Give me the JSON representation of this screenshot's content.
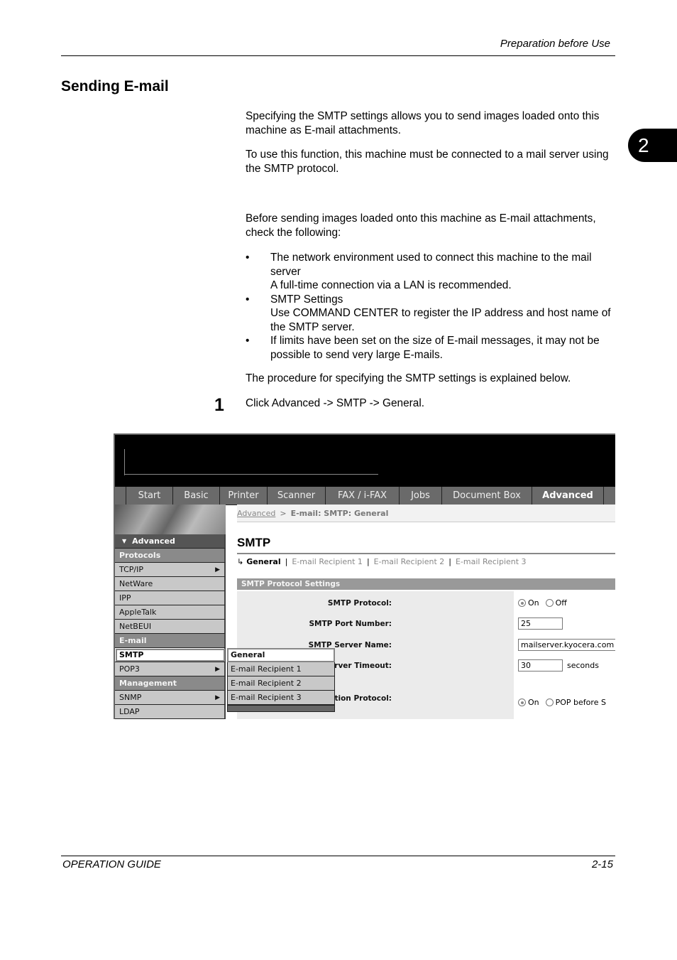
{
  "header": {
    "section_title": "Preparation before Use"
  },
  "chapter_tab": "2",
  "title": "Sending E-mail",
  "intro": [
    "Specifying the SMTP settings allows you to send images loaded onto this machine as E-mail attachments.",
    "To use this function, this machine must be connected to a mail server using the SMTP protocol."
  ],
  "check_intro": "Before sending images loaded onto this machine as E-mail attachments, check the following:",
  "bullets": [
    {
      "lines": [
        "The network environment used to connect this machine to the mail server",
        "A full-time connection via a LAN is recommended."
      ]
    },
    {
      "lines": [
        "SMTP Settings",
        "Use COMMAND CENTER to register the IP address and host name of the SMTP server."
      ]
    },
    {
      "lines": [
        "If limits have been set on the size of E-mail messages, it may not be possible to send very large E-mails."
      ]
    }
  ],
  "bullet_char": "•",
  "procedure_intro": "The procedure for specifying the SMTP settings is explained below.",
  "steps": [
    {
      "number": "1",
      "text": "Click Advanced -> SMTP -> General."
    }
  ],
  "screenshot": {
    "nav_tabs": [
      {
        "label": "Start"
      },
      {
        "label": "Basic"
      },
      {
        "label": "Printer"
      },
      {
        "label": "Scanner"
      },
      {
        "label": "FAX / i-FAX"
      },
      {
        "label": "Jobs"
      },
      {
        "label": "Document Box"
      },
      {
        "label": "Advanced",
        "active": true
      }
    ],
    "sidebar": {
      "header": "Advanced",
      "items": [
        {
          "label": "Protocols",
          "type": "group"
        },
        {
          "label": "TCP/IP",
          "arrow": true
        },
        {
          "label": "NetWare"
        },
        {
          "label": "IPP"
        },
        {
          "label": "AppleTalk"
        },
        {
          "label": "NetBEUI"
        },
        {
          "label": "E-mail",
          "type": "group"
        },
        {
          "label": "SMTP",
          "selected": true
        },
        {
          "label": "POP3",
          "arrow": true
        },
        {
          "label": "Management",
          "type": "group"
        },
        {
          "label": "SNMP",
          "arrow": true
        },
        {
          "label": "LDAP"
        }
      ]
    },
    "submenu": [
      {
        "label": "General",
        "selected": true
      },
      {
        "label": "E-mail Recipient 1"
      },
      {
        "label": "E-mail Recipient 2"
      },
      {
        "label": "E-mail Recipient 3"
      }
    ],
    "breadcrumb": {
      "link": "Advanced",
      "separator": ">",
      "current": "E-mail: SMTP: General"
    },
    "page_heading": "SMTP",
    "subtabs": {
      "current": "General",
      "others": [
        "E-mail Recipient 1",
        "E-mail Recipient 2",
        "E-mail Recipient 3"
      ]
    },
    "settings_heading": "SMTP Protocol Settings",
    "fields": {
      "smtp_protocol": {
        "label": "SMTP Protocol:",
        "options": [
          "On",
          "Off"
        ],
        "selected": "On"
      },
      "port": {
        "label": "SMTP Port Number:",
        "value": "25"
      },
      "server_name": {
        "label": "SMTP Server Name:",
        "value": "mailserver.kyocera.com"
      },
      "timeout": {
        "label": "SMTP Server Timeout:",
        "value": "30",
        "unit": "seconds"
      },
      "auth_protocol": {
        "label": "Authentication Protocol:",
        "options": [
          "On",
          "POP before S"
        ],
        "selected": "On"
      }
    }
  },
  "footer": {
    "left": "OPERATION GUIDE",
    "right": "2-15"
  }
}
